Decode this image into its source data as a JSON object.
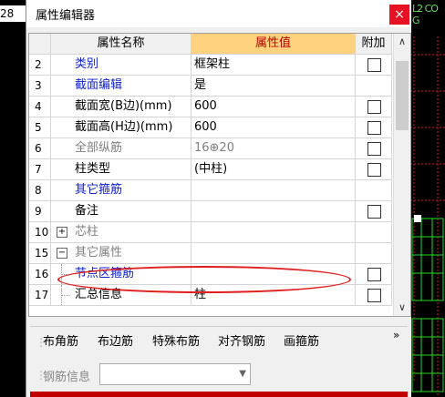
{
  "left_partial": "28",
  "right_partial": "L2 CO G",
  "window": {
    "title": "属性编辑器",
    "close_icon": "close-icon"
  },
  "table": {
    "headers": {
      "num": "",
      "name": "属性名称",
      "value": "属性值",
      "extra": "附加"
    },
    "rows": [
      {
        "num": "2",
        "name": "类别",
        "value": "框架柱",
        "name_color": "blue",
        "checkbox": true
      },
      {
        "num": "3",
        "name": "截面编辑",
        "value": "是",
        "name_color": "blue",
        "checkbox": false
      },
      {
        "num": "4",
        "name": "截面宽(B边)(mm)",
        "value": "600",
        "name_color": "black",
        "checkbox": true
      },
      {
        "num": "5",
        "name": "截面高(H边)(mm)",
        "value": "600",
        "name_color": "black",
        "checkbox": true
      },
      {
        "num": "6",
        "name": "全部纵筋",
        "value": "16⊕20",
        "name_color": "gray",
        "checkbox": true
      },
      {
        "num": "7",
        "name": "柱类型",
        "value": "(中柱)",
        "name_color": "black",
        "checkbox": true
      },
      {
        "num": "8",
        "name": "其它箍筋",
        "value": "",
        "name_color": "blue",
        "checkbox": false
      },
      {
        "num": "9",
        "name": "备注",
        "value": "",
        "name_color": "black",
        "checkbox": true
      },
      {
        "num": "10",
        "name": "芯柱",
        "value": "",
        "name_color": "gray",
        "checkbox": false,
        "tree": "+"
      },
      {
        "num": "15",
        "name": "其它属性",
        "value": "",
        "name_color": "gray",
        "checkbox": false,
        "tree": "−"
      },
      {
        "num": "16",
        "name": "节点区箍筋",
        "value": "",
        "name_color": "blue",
        "checkbox": true,
        "child": true
      },
      {
        "num": "17",
        "name": "汇总信息",
        "value": "柱",
        "name_color": "black",
        "checkbox": true,
        "child": true
      }
    ]
  },
  "toolbar": {
    "buttons": [
      "布角筋",
      "布边筋",
      "特殊布筋",
      "对齐钢筋",
      "画箍筋"
    ],
    "more": "»",
    "rebar_info_label": "钢筋信息",
    "rebar_info_value": ""
  },
  "colors": {
    "header_value_bg": "#ffd27f",
    "header_value_text": "#c00000",
    "link_blue": "#1020d0",
    "close_red": "#e81123",
    "highlight_ellipse": "#e02020"
  }
}
